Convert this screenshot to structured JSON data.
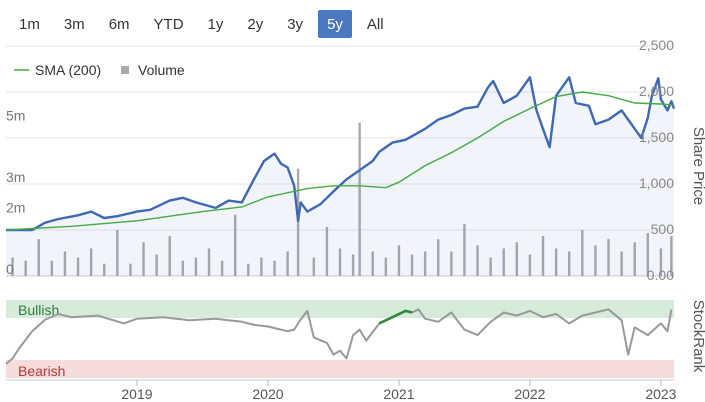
{
  "range_buttons": [
    {
      "label": "1m",
      "active": false
    },
    {
      "label": "3m",
      "active": false
    },
    {
      "label": "6m",
      "active": false
    },
    {
      "label": "YTD",
      "active": false
    },
    {
      "label": "1y",
      "active": false
    },
    {
      "label": "2y",
      "active": false
    },
    {
      "label": "3y",
      "active": false
    },
    {
      "label": "5y",
      "active": true
    },
    {
      "label": "All",
      "active": false
    }
  ],
  "chart_data": {
    "type": "line",
    "legend": {
      "placement": "top-left",
      "items": [
        {
          "label": "SMA (200)",
          "color": "#44aa44",
          "symbol": "line"
        },
        {
          "label": "Volume",
          "color": "#aaaaaa",
          "symbol": "square"
        }
      ]
    },
    "price_axis": {
      "label": "Share Price",
      "ticks": [
        "2,500",
        "2,000",
        "1,500",
        "1,000",
        "500",
        "0.00"
      ],
      "tick_values": [
        2500,
        2000,
        1500,
        1000,
        500,
        0
      ],
      "range": [
        0,
        2500
      ],
      "position": "right"
    },
    "volume_axis": {
      "ticks": [
        "5m",
        "3m",
        "2m",
        "0"
      ],
      "tick_values": [
        5,
        3,
        2,
        0
      ],
      "range": [
        0,
        7.5
      ],
      "unit": "m",
      "position": "left"
    },
    "time_axis": {
      "range": [
        2018.0,
        2023.1
      ],
      "ticks": [
        "2019",
        "2020",
        "2021",
        "2022",
        "2023"
      ],
      "tick_values": [
        2019,
        2020,
        2021,
        2022,
        2023
      ]
    },
    "grid": true,
    "series": [
      {
        "name": "Share Price",
        "color": "#3f68b4",
        "t": [
          2018.0,
          2018.2,
          2018.3,
          2018.4,
          2018.55,
          2018.65,
          2018.75,
          2018.85,
          2019.0,
          2019.1,
          2019.25,
          2019.35,
          2019.45,
          2019.6,
          2019.7,
          2019.8,
          2019.9,
          2019.97,
          2020.05,
          2020.1,
          2020.15,
          2020.2,
          2020.23,
          2020.25,
          2020.3,
          2020.4,
          2020.5,
          2020.6,
          2020.7,
          2020.8,
          2020.85,
          2020.95,
          2021.05,
          2021.2,
          2021.3,
          2021.4,
          2021.5,
          2021.6,
          2021.68,
          2021.72,
          2021.8,
          2021.9,
          2022.0,
          2022.05,
          2022.1,
          2022.15,
          2022.2,
          2022.3,
          2022.35,
          2022.45,
          2022.5,
          2022.6,
          2022.7,
          2022.8,
          2022.85,
          2022.9,
          2022.93,
          2022.98,
          2023.0,
          2023.05,
          2023.08,
          2023.1
        ],
        "values": [
          500,
          500,
          580,
          620,
          660,
          700,
          630,
          650,
          700,
          720,
          820,
          850,
          800,
          740,
          820,
          800,
          1070,
          1250,
          1330,
          1220,
          1180,
          980,
          600,
          800,
          700,
          780,
          920,
          1050,
          1150,
          1250,
          1350,
          1450,
          1480,
          1600,
          1700,
          1750,
          1820,
          1840,
          2050,
          2120,
          1880,
          1960,
          2160,
          1800,
          1600,
          1400,
          1960,
          2160,
          1880,
          1850,
          1650,
          1700,
          1800,
          1600,
          1500,
          1720,
          1950,
          2150,
          1920,
          1800,
          1900,
          1820
        ]
      },
      {
        "name": "SMA (200)",
        "color": "#44aa44",
        "t": [
          2018.0,
          2018.5,
          2019.0,
          2019.5,
          2019.8,
          2020.0,
          2020.3,
          2020.5,
          2020.7,
          2020.9,
          2021.0,
          2021.2,
          2021.4,
          2021.6,
          2021.8,
          2022.0,
          2022.2,
          2022.4,
          2022.6,
          2022.8,
          2023.0,
          2023.1
        ],
        "values": [
          500,
          540,
          600,
          700,
          750,
          860,
          950,
          980,
          980,
          960,
          1020,
          1200,
          1340,
          1500,
          1680,
          1820,
          1950,
          2000,
          1960,
          1880,
          1870,
          1860
        ]
      },
      {
        "name": "Volume",
        "color": "#aaaaaa",
        "unit": "m",
        "t": [
          2018.05,
          2018.15,
          2018.25,
          2018.35,
          2018.45,
          2018.55,
          2018.65,
          2018.75,
          2018.85,
          2018.95,
          2019.05,
          2019.15,
          2019.25,
          2019.35,
          2019.45,
          2019.55,
          2019.65,
          2019.75,
          2019.85,
          2019.95,
          2020.05,
          2020.15,
          2020.23,
          2020.35,
          2020.45,
          2020.55,
          2020.65,
          2020.7,
          2020.8,
          2020.9,
          2021.0,
          2021.1,
          2021.2,
          2021.3,
          2021.4,
          2021.5,
          2021.6,
          2021.7,
          2021.8,
          2021.9,
          2022.0,
          2022.1,
          2022.2,
          2022.3,
          2022.4,
          2022.5,
          2022.6,
          2022.7,
          2022.8,
          2022.9,
          2023.0,
          2023.08
        ],
        "values": [
          0.6,
          0.5,
          1.2,
          0.5,
          0.8,
          0.6,
          0.9,
          0.4,
          1.5,
          0.4,
          1.1,
          0.7,
          1.3,
          0.5,
          0.6,
          0.9,
          0.5,
          2.0,
          0.4,
          0.6,
          0.5,
          0.8,
          3.5,
          0.6,
          1.6,
          0.9,
          0.7,
          5.0,
          0.8,
          0.6,
          1.0,
          0.7,
          0.8,
          1.2,
          0.8,
          1.7,
          1.0,
          0.6,
          0.9,
          1.1,
          0.7,
          1.3,
          0.9,
          0.8,
          1.5,
          1.0,
          1.2,
          0.8,
          1.1,
          1.4,
          0.9,
          1.3
        ]
      }
    ],
    "stockrank": {
      "label": "StockRank",
      "zones": {
        "top": "Bullish",
        "bottom": "Bearish"
      },
      "range": [
        0,
        100
      ],
      "line_color": "#999999",
      "highlight_color": "#2f8a3b",
      "t": [
        2018.0,
        2018.05,
        2018.1,
        2018.2,
        2018.3,
        2018.4,
        2018.5,
        2018.7,
        2018.9,
        2019.0,
        2019.2,
        2019.4,
        2019.6,
        2019.8,
        2019.9,
        2020.0,
        2020.15,
        2020.2,
        2020.25,
        2020.3,
        2020.35,
        2020.45,
        2020.5,
        2020.55,
        2020.6,
        2020.65,
        2020.7,
        2020.75,
        2020.85,
        2020.95,
        2021.05,
        2021.1,
        2021.15,
        2021.2,
        2021.3,
        2021.4,
        2021.5,
        2021.6,
        2021.7,
        2021.8,
        2021.9,
        2022.0,
        2022.1,
        2022.2,
        2022.3,
        2022.4,
        2022.5,
        2022.6,
        2022.7,
        2022.75,
        2022.8,
        2022.9,
        2023.0,
        2023.05,
        2023.08
      ],
      "values": [
        18,
        25,
        38,
        60,
        75,
        82,
        78,
        80,
        70,
        76,
        78,
        74,
        76,
        72,
        68,
        66,
        60,
        62,
        75,
        86,
        52,
        45,
        30,
        35,
        25,
        55,
        62,
        48,
        70,
        78,
        86,
        84,
        88,
        76,
        72,
        84,
        62,
        55,
        72,
        84,
        80,
        86,
        78,
        82,
        70,
        80,
        84,
        88,
        74,
        30,
        65,
        55,
        70,
        60,
        88
      ],
      "highlights": [
        [
          2020.8,
          2021.1
        ]
      ]
    }
  }
}
